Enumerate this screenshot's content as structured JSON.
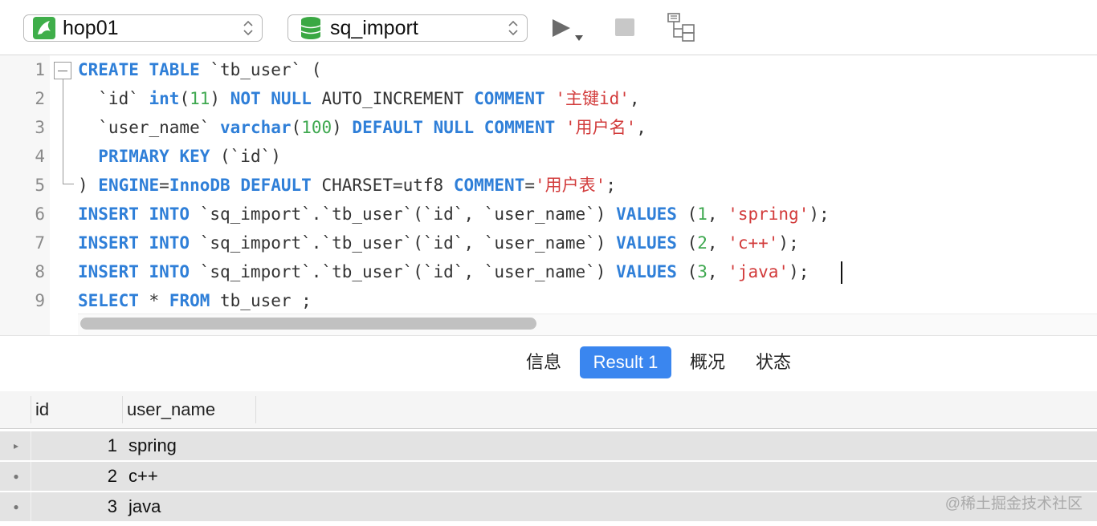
{
  "toolbar": {
    "connection": "hop01",
    "database": "sq_import",
    "icons": [
      "mysql-dolphin-icon",
      "database-icon",
      "run-icon",
      "stop-icon",
      "explain-icon"
    ]
  },
  "editor": {
    "line_numbers": [
      "1",
      "2",
      "3",
      "4",
      "5",
      "6",
      "7",
      "8",
      "9"
    ],
    "lines": [
      [
        {
          "t": "kw",
          "v": "CREATE TABLE"
        },
        {
          "t": "plain",
          "v": " `tb_user` ("
        }
      ],
      [
        {
          "t": "plain",
          "v": "  `id` "
        },
        {
          "t": "kw",
          "v": "int"
        },
        {
          "t": "plain",
          "v": "("
        },
        {
          "t": "num",
          "v": "11"
        },
        {
          "t": "plain",
          "v": ") "
        },
        {
          "t": "kw",
          "v": "NOT NULL"
        },
        {
          "t": "plain",
          "v": " AUTO_INCREMENT "
        },
        {
          "t": "kw",
          "v": "COMMENT"
        },
        {
          "t": "plain",
          "v": " "
        },
        {
          "t": "str",
          "v": "'主键id'"
        },
        {
          "t": "plain",
          "v": ","
        }
      ],
      [
        {
          "t": "plain",
          "v": "  `user_name` "
        },
        {
          "t": "kw",
          "v": "varchar"
        },
        {
          "t": "plain",
          "v": "("
        },
        {
          "t": "num",
          "v": "100"
        },
        {
          "t": "plain",
          "v": ") "
        },
        {
          "t": "kw",
          "v": "DEFAULT NULL COMMENT"
        },
        {
          "t": "plain",
          "v": " "
        },
        {
          "t": "str",
          "v": "'用户名'"
        },
        {
          "t": "plain",
          "v": ","
        }
      ],
      [
        {
          "t": "plain",
          "v": "  "
        },
        {
          "t": "kw",
          "v": "PRIMARY KEY"
        },
        {
          "t": "plain",
          "v": " (`id`)"
        }
      ],
      [
        {
          "t": "plain",
          "v": ") "
        },
        {
          "t": "kw",
          "v": "ENGINE"
        },
        {
          "t": "plain",
          "v": "="
        },
        {
          "t": "kw",
          "v": "InnoDB DEFAULT"
        },
        {
          "t": "plain",
          "v": " CHARSET=utf8 "
        },
        {
          "t": "kw",
          "v": "COMMENT"
        },
        {
          "t": "plain",
          "v": "="
        },
        {
          "t": "str",
          "v": "'用户表'"
        },
        {
          "t": "plain",
          "v": ";"
        }
      ],
      [
        {
          "t": "kw",
          "v": "INSERT INTO"
        },
        {
          "t": "plain",
          "v": " `sq_import`.`tb_user`(`id`, `user_name`) "
        },
        {
          "t": "kw",
          "v": "VALUES"
        },
        {
          "t": "plain",
          "v": " ("
        },
        {
          "t": "num",
          "v": "1"
        },
        {
          "t": "plain",
          "v": ", "
        },
        {
          "t": "str",
          "v": "'spring'"
        },
        {
          "t": "plain",
          "v": ");"
        }
      ],
      [
        {
          "t": "kw",
          "v": "INSERT INTO"
        },
        {
          "t": "plain",
          "v": " `sq_import`.`tb_user`(`id`, `user_name`) "
        },
        {
          "t": "kw",
          "v": "VALUES"
        },
        {
          "t": "plain",
          "v": " ("
        },
        {
          "t": "num",
          "v": "2"
        },
        {
          "t": "plain",
          "v": ", "
        },
        {
          "t": "str",
          "v": "'c++'"
        },
        {
          "t": "plain",
          "v": ");"
        }
      ],
      [
        {
          "t": "kw",
          "v": "INSERT INTO"
        },
        {
          "t": "plain",
          "v": " `sq_import`.`tb_user`(`id`, `user_name`) "
        },
        {
          "t": "kw",
          "v": "VALUES"
        },
        {
          "t": "plain",
          "v": " ("
        },
        {
          "t": "num",
          "v": "3"
        },
        {
          "t": "plain",
          "v": ", "
        },
        {
          "t": "str",
          "v": "'java'"
        },
        {
          "t": "plain",
          "v": ");"
        }
      ],
      [
        {
          "t": "kw",
          "v": "SELECT"
        },
        {
          "t": "plain",
          "v": " * "
        },
        {
          "t": "kw",
          "v": "FROM"
        },
        {
          "t": "plain",
          "v": " tb_user ;"
        }
      ]
    ]
  },
  "tabs": [
    {
      "label": "信息",
      "active": false
    },
    {
      "label": "Result 1",
      "active": true
    },
    {
      "label": "概况",
      "active": false
    },
    {
      "label": "状态",
      "active": false
    }
  ],
  "grid": {
    "columns": [
      "id",
      "user_name"
    ],
    "rows": [
      {
        "marker": "▸",
        "id": "1",
        "user_name": "spring"
      },
      {
        "marker": "●",
        "id": "2",
        "user_name": "c++"
      },
      {
        "marker": "●",
        "id": "3",
        "user_name": "java"
      }
    ]
  },
  "watermark": "@稀土掘金技术社区",
  "colors": {
    "keyword": "#2f7fd8",
    "string": "#d23b3b",
    "number": "#3ea84f",
    "active_tab": "#3a86ef"
  }
}
